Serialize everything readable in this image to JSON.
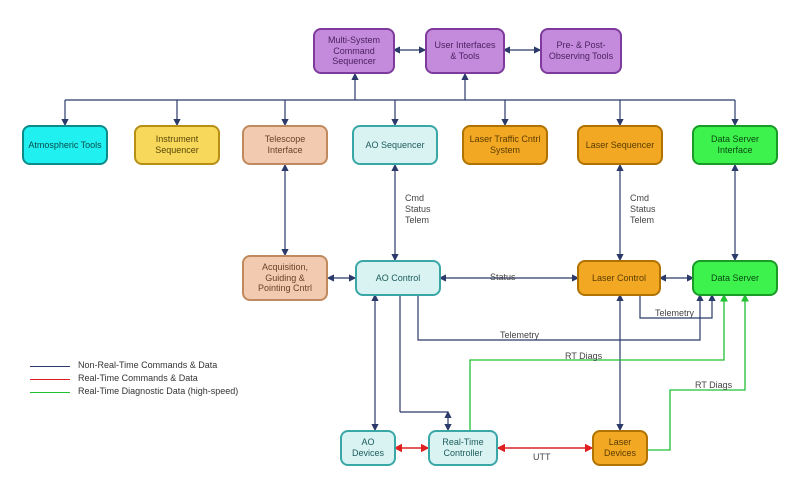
{
  "boxes": {
    "multiseq": "Multi-System Command Sequencer",
    "ui": "User Interfaces & Tools",
    "prepost": "Pre- & Post-Observing Tools",
    "atmos": "Atmospheric Tools",
    "instseq": "Instrument Sequencer",
    "telif": "Telescope Interface",
    "aoseq": "AO Sequencer",
    "ltcs": "Laser Traffic Cntrl System",
    "laserseq": "Laser Sequencer",
    "dsif": "Data Server Interface",
    "agp": "Acquisition, Guiding & Pointing Cntrl",
    "aoctrl": "AO Control",
    "laserctrl": "Laser Control",
    "dataserver": "Data Server",
    "aodev": "AO Devices",
    "rtc": "Real-Time Controller",
    "laserdev": "Laser Devices"
  },
  "edge_labels": {
    "cmd1": "Cmd Status Telem",
    "cmd2": "Cmd Status Telem",
    "status": "Status",
    "telem1": "Telemetry",
    "telem2": "Telemetry",
    "rt1": "RT Diags",
    "rt2": "RT Diags",
    "utt": "UTT"
  },
  "legend": {
    "navy": "Non-Real-Time Commands & Data",
    "red": "Real-Time Commands & Data",
    "green": "Real-Time Diagnostic Data (high-speed)"
  },
  "colors": {
    "navy": "#2b3a6b",
    "red": "#e02020",
    "green": "#20c030"
  }
}
